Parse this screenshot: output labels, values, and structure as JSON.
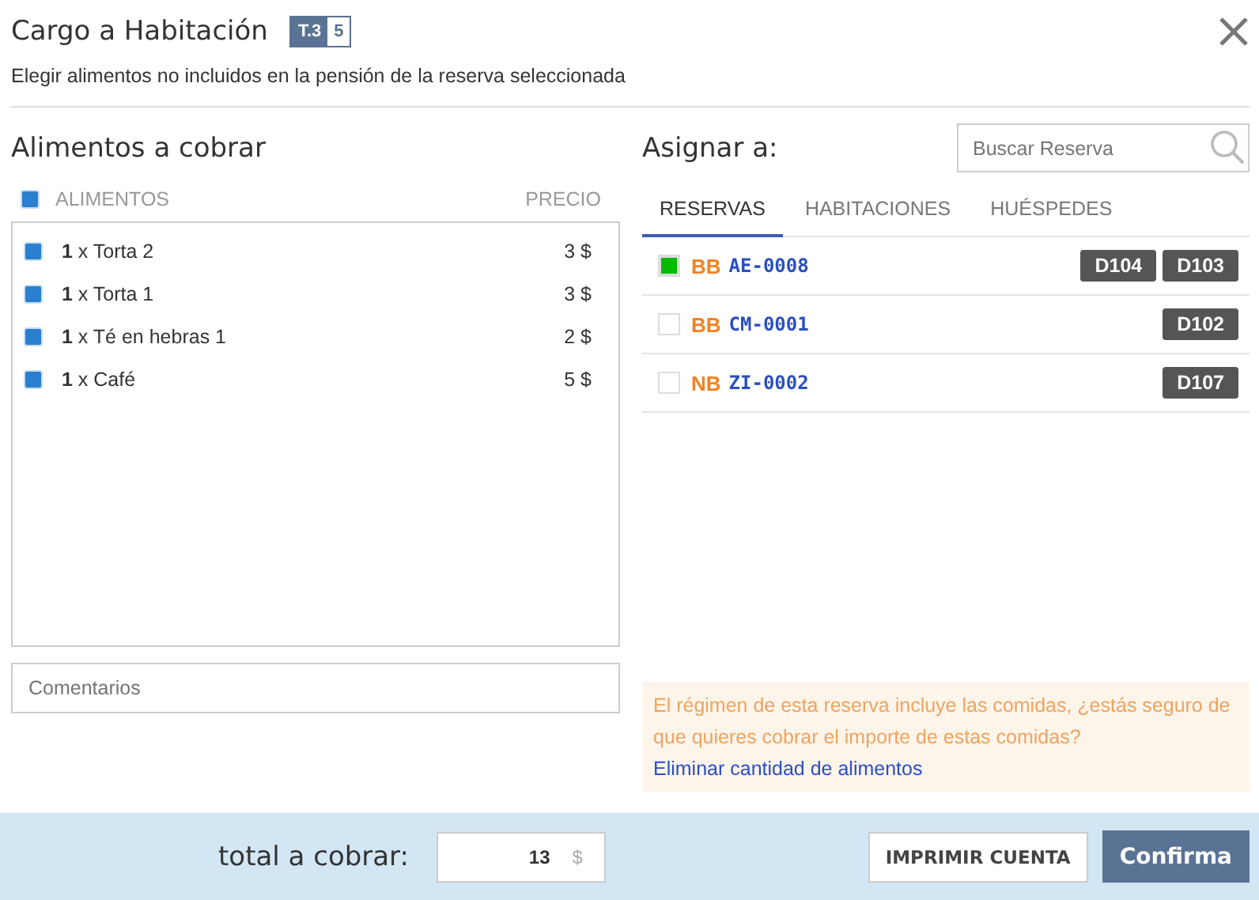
{
  "dialog": {
    "title": "Cargo a Habitación",
    "badge": {
      "label": "T.3",
      "count": "5"
    },
    "subtitle": "Elegir alimentos no incluidos en la pensión de la reserva seleccionada"
  },
  "foods": {
    "heading": "Alimentos a cobrar",
    "all_checked": true,
    "columns": [
      "ALIMENTOS",
      "PRECIO"
    ],
    "items": [
      {
        "text": "**1** x Torta 2",
        "price": "3 $",
        "checked": true
      },
      {
        "text": "**1** x Torta 1",
        "price": "3 $",
        "checked": true
      },
      {
        "text": "**1** x Té en hebras 1",
        "price": "2 $",
        "checked": true
      },
      {
        "text": "**1** x Café",
        "price": "5 $",
        "checked": true
      }
    ],
    "comments_placeholder": "Comentarios"
  },
  "assign": {
    "heading": "Asignar a:",
    "search_placeholder": "Buscar Reserva",
    "tabs": [
      {
        "label": "RESERVAS",
        "selected": true
      },
      {
        "label": "HABITACIONES",
        "selected": false
      },
      {
        "label": "HUÉSPEDES",
        "selected": false
      }
    ],
    "reservations": [
      {
        "board": "BB",
        "code": "AE-0008",
        "rooms": [
          "D104",
          "D103"
        ],
        "checked": true
      },
      {
        "board": "BB",
        "code": "CM-0001",
        "rooms": [
          "D102"
        ],
        "checked": false
      },
      {
        "board": "NB",
        "code": "ZI-0002",
        "rooms": [
          "D107"
        ],
        "checked": false
      }
    ],
    "warning": {
      "text": "El régimen de esta reserva incluye las comidas, ¿estás seguro de que quieres cobrar el importe de estas comidas?",
      "link": "Eliminar cantidad de alimentos"
    }
  },
  "footer": {
    "total_label": "total a cobrar:",
    "total_value": "13",
    "currency": "$",
    "print_button": "IMPRIMIR CUENTA",
    "confirm_button": "Confirma"
  }
}
